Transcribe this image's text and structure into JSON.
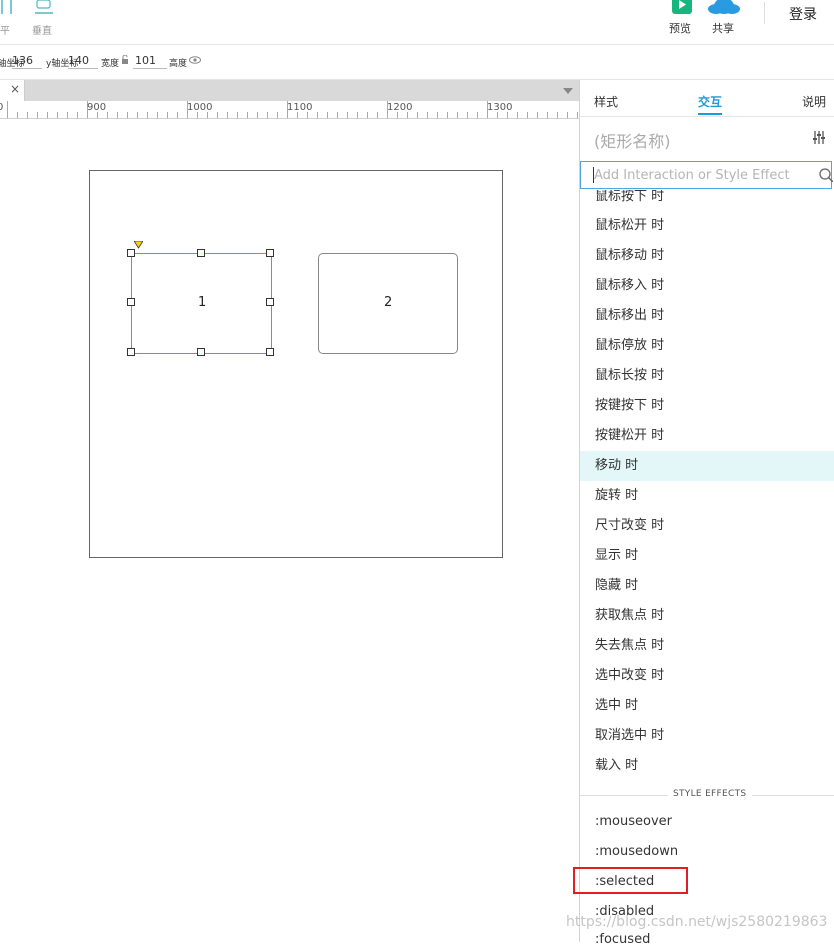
{
  "toolbar": {
    "left_labels": [
      "平",
      "垂直"
    ],
    "preview_label": "预览",
    "share_label": "共享",
    "login_label": "登录",
    "colors": {
      "preview_icon": "#19b57f",
      "share_icon": "#2a9be0"
    }
  },
  "propbar": {
    "x_label": "x轴坐标",
    "x_value": "136",
    "y_label": "y轴坐标",
    "y_value": "140",
    "w_label": "宽度",
    "w_value": "101",
    "h_label": "高度"
  },
  "canvas": {
    "close_glyph": "×",
    "ruler_labels": [
      "0",
      "900",
      "1000",
      "1100",
      "1200",
      "1300"
    ],
    "rect1_label": "1",
    "rect2_label": "2"
  },
  "panel": {
    "tabs": [
      "样式",
      "交互",
      "说明"
    ],
    "active_tab": "交互",
    "widget_name": "(矩形名称)",
    "search_placeholder": "Add Interaction or Style Effect",
    "events": [
      "鼠标按下 时",
      "鼠标松开 时",
      "鼠标移动 时",
      "鼠标移入 时",
      "鼠标移出 时",
      "鼠标停放 时",
      "鼠标长按 时",
      "按键按下 时",
      "按键松开 时",
      "移动 时",
      "旋转 时",
      "尺寸改变 时",
      "显示 时",
      "隐藏 时",
      "获取焦点 时",
      "失去焦点 时",
      "选中改变 时",
      "选中 时",
      "取消选中 时",
      "载入 时"
    ],
    "highlighted_event": "移动 时",
    "style_effects_label": "STYLE EFFECTS",
    "style_effects": [
      ":mouseover",
      ":mousedown",
      ":selected",
      ":disabled",
      ":focused"
    ]
  },
  "watermark": "https://blog.csdn.net/wjs2580219863",
  "colors": {
    "accent": "#1e9ad6",
    "selection": "#21b5c8",
    "highlight_row": "#e3f7f8",
    "annotation": "#e02020"
  }
}
